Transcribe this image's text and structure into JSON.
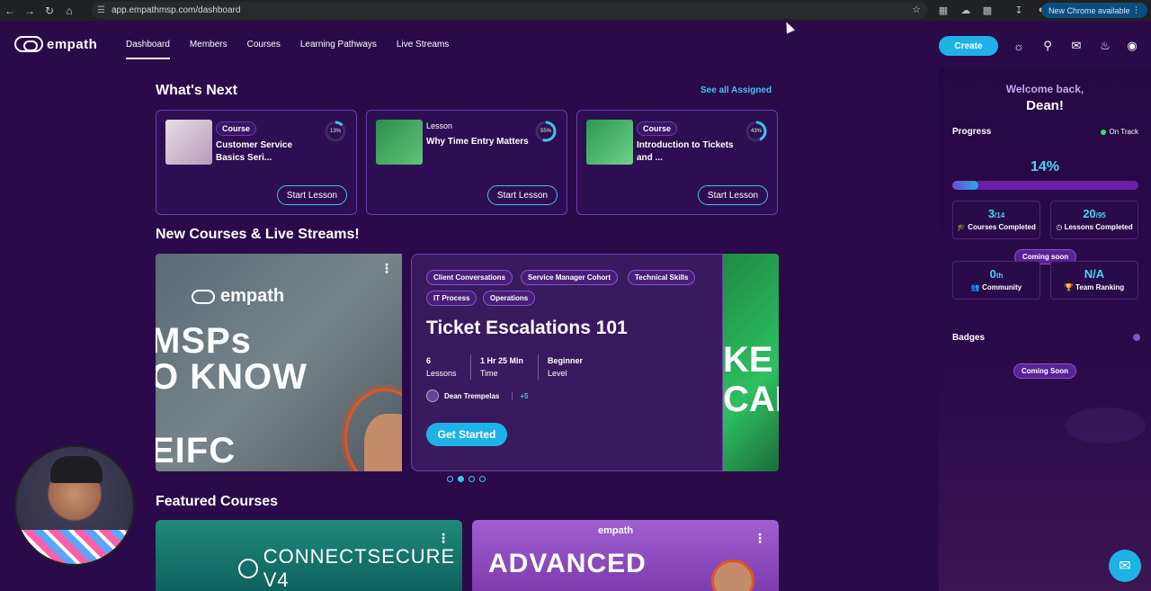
{
  "browser": {
    "url": "app.empathmsp.com/dashboard",
    "update_label": "New Chrome available"
  },
  "header": {
    "logo_text": "empath",
    "nav": [
      "Dashboard",
      "Members",
      "Courses",
      "Learning Pathways",
      "Live Streams"
    ],
    "active_nav": "Dashboard",
    "create_label": "Create"
  },
  "whats_next": {
    "title": "What's Next",
    "see_all": "See all Assigned",
    "cards": [
      {
        "type": "Course",
        "title": "Customer Service Basics Seri...",
        "progress_label": "13%",
        "progress": 13,
        "button": "Start Lesson"
      },
      {
        "type": "Lesson",
        "title": "Why Time Entry Matters",
        "progress_label": "55%",
        "progress": 55,
        "button": "Start Lesson"
      },
      {
        "type": "Course",
        "title": "Introduction to Tickets and ...",
        "progress_label": "43%",
        "progress": 43,
        "button": "Start Lesson"
      }
    ]
  },
  "new_courses": {
    "title": "New Courses & Live Streams!",
    "left_slide": {
      "logo": "empath",
      "lines": [
        "MSPs",
        "O KNOW",
        "EIFC"
      ]
    },
    "featured": {
      "tags": [
        "Client Conversations",
        "Service Manager Cohort",
        "Technical Skills",
        "IT Process",
        "Operations"
      ],
      "title": "Ticket Escalations 101",
      "stats": [
        {
          "value": "6",
          "label": "Lessons"
        },
        {
          "value": "1 Hr 25 Min",
          "label": "Time"
        },
        {
          "value": "Beginner",
          "label": "Level"
        }
      ],
      "author": "Dean Trempelas",
      "extra_authors": "+5",
      "cta": "Get Started"
    },
    "right_slide": {
      "lines": [
        "KE",
        "CAI"
      ]
    },
    "dots": 4,
    "active_dot": 1
  },
  "featured_courses": {
    "title": "Featured Courses",
    "cards": [
      {
        "label": "CONNECTSECURE V4"
      },
      {
        "logo": "empath",
        "label": "ADVANCED"
      }
    ]
  },
  "sidebar": {
    "welcome": "Welcome back,",
    "name": "Dean!",
    "progress_label": "Progress",
    "status": "On Track",
    "percent": "14%",
    "percent_value": 14,
    "stats": [
      {
        "num": "3",
        "den": "/14",
        "label": "Courses Completed"
      },
      {
        "num": "20",
        "den": "/95",
        "label": "Lessons Completed"
      },
      {
        "num": "0",
        "den": "th",
        "label": "Community"
      },
      {
        "num": "N/A",
        "den": "",
        "label": "Team Ranking"
      }
    ],
    "coming_soon_stats": "Coming soon",
    "badges_label": "Badges",
    "coming_soon_badges": "Coming Soon"
  },
  "colors": {
    "background": "#2b0a4a",
    "accent": "#1fb2e6",
    "link": "#40c2ef"
  }
}
